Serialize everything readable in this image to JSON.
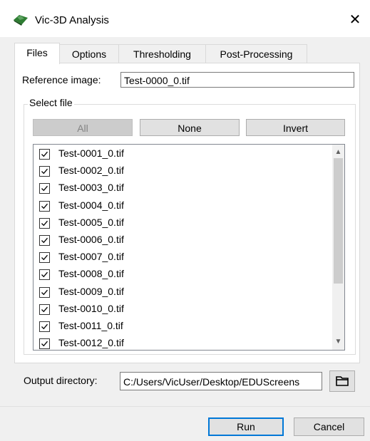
{
  "window": {
    "title": "Vic-3D Analysis",
    "close_glyph": "✕"
  },
  "tabs": [
    {
      "label": "Files",
      "active": true
    },
    {
      "label": "Options",
      "active": false
    },
    {
      "label": "Thresholding",
      "active": false
    },
    {
      "label": "Post-Processing",
      "active": false
    }
  ],
  "reference": {
    "label": "Reference image:",
    "value": "Test-0000_0.tif"
  },
  "select_file": {
    "title": "Select file",
    "buttons": {
      "all": "All",
      "none": "None",
      "invert": "Invert"
    },
    "items": [
      {
        "label": "Test-0001_0.tif",
        "checked": true
      },
      {
        "label": "Test-0002_0.tif",
        "checked": true
      },
      {
        "label": "Test-0003_0.tif",
        "checked": true
      },
      {
        "label": "Test-0004_0.tif",
        "checked": true
      },
      {
        "label": "Test-0005_0.tif",
        "checked": true
      },
      {
        "label": "Test-0006_0.tif",
        "checked": true
      },
      {
        "label": "Test-0007_0.tif",
        "checked": true
      },
      {
        "label": "Test-0008_0.tif",
        "checked": true
      },
      {
        "label": "Test-0009_0.tif",
        "checked": true
      },
      {
        "label": "Test-0010_0.tif",
        "checked": true
      },
      {
        "label": "Test-0011_0.tif",
        "checked": true
      },
      {
        "label": "Test-0012_0.tif",
        "checked": true
      }
    ]
  },
  "output": {
    "label": "Output directory:",
    "value": "C:/Users/VicUser/Desktop/EDUScreens",
    "browse_icon": "folder-icon"
  },
  "footer": {
    "run": "Run",
    "cancel": "Cancel"
  },
  "colors": {
    "accent": "#0078d7",
    "panel": "#ffffff",
    "chrome": "#f0f0f0"
  }
}
